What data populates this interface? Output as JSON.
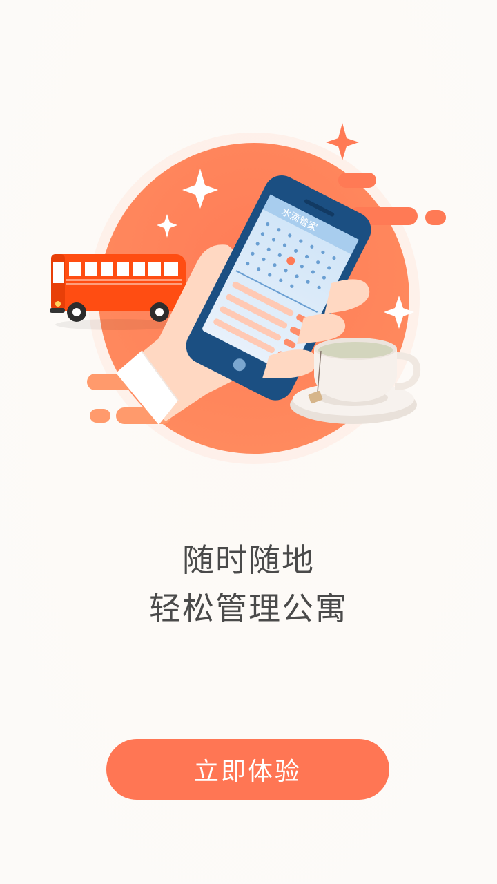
{
  "app": {
    "brand_on_phone": "水滴管家"
  },
  "intro": {
    "line1": "随时随地",
    "line2": "轻松管理公寓"
  },
  "cta": {
    "label": "立即体验"
  },
  "colors": {
    "accent": "#ff7654",
    "circle": "#ff7a55",
    "bus": "#ff4d12",
    "text": "#4a4a4a",
    "background": "#fdfbf8"
  },
  "icons": {
    "illustration": "hand-holding-phone-illustration",
    "bus": "bus-icon",
    "cup": "tea-cup-icon",
    "sparkle": "sparkle-icon"
  }
}
